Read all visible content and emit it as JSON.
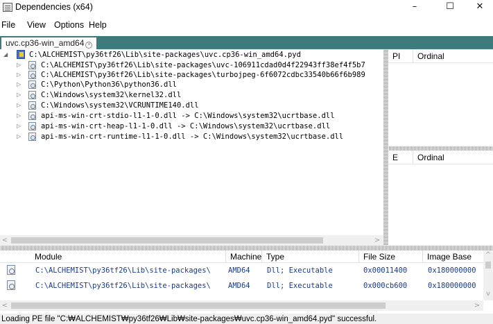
{
  "window": {
    "title": "Dependencies (x64)",
    "minimize": "–",
    "maximize": "☐",
    "close": "✕"
  },
  "menu": [
    "File",
    "View",
    "Options",
    "Help"
  ],
  "tabs": [
    {
      "label": "uvc.cp36-win_amd64",
      "close": "✕"
    }
  ],
  "tree": {
    "root": "C:\\ALCHEMIST\\py36tf26\\Lib\\site-packages\\uvc.cp36-win_amd64.pyd",
    "children": [
      "C:\\ALCHEMIST\\py36tf26\\Lib\\site-packages\\uvc-106911cdad0d4f22943ff38ef4f5b7",
      "C:\\ALCHEMIST\\py36tf26\\Lib\\site-packages\\turbojpeg-6f6072cdbc33540b66f6b989",
      "C:\\Python\\Python36\\python36.dll",
      "C:\\Windows\\system32\\kernel32.dll",
      "C:\\Windows\\system32\\VCRUNTIME140.dll",
      "api-ms-win-crt-stdio-l1-1-0.dll -> C:\\Windows\\system32\\ucrtbase.dll",
      "api-ms-win-crt-heap-l1-1-0.dll -> C:\\Windows\\system32\\ucrtbase.dll",
      "api-ms-win-crt-runtime-l1-1-0.dll -> C:\\Windows\\system32\\ucrtbase.dll"
    ]
  },
  "imports_panel": {
    "col1": "PI",
    "col2": "Ordinal"
  },
  "exports_panel": {
    "col1": "E",
    "col2": "Ordinal"
  },
  "modules": {
    "headers": [
      "Module",
      "Machine",
      "Type",
      "File Size",
      "Image Base"
    ],
    "rows": [
      [
        "C:\\ALCHEMIST\\py36tf26\\Lib\\site-packages\\",
        "AMD64",
        "Dll; Executable",
        "0x00011400",
        "0x180000000"
      ],
      [
        "C:\\ALCHEMIST\\py36tf26\\Lib\\site-packages\\",
        "AMD64",
        "Dll; Executable",
        "0x000cb600",
        "0x180000000"
      ]
    ]
  },
  "scroll_arrows": {
    "left": "<",
    "right": ">",
    "up": "^",
    "down": "v"
  },
  "status": "Loading PE file \"C:₩ALCHEMIST₩py36tf26₩Lib₩site-packages₩uvc.cp36-win_amd64.pyd\" successful."
}
